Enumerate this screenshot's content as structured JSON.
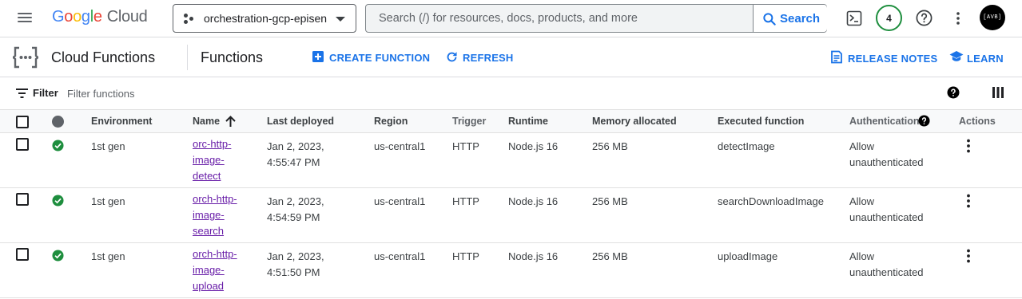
{
  "header": {
    "logo_letters": [
      "G",
      "o",
      "o",
      "g",
      "l",
      "e"
    ],
    "logo_product": "Cloud",
    "project_name": "orchestration-gcp-episen",
    "search_placeholder": "Search (/) for resources, docs, products, and more",
    "search_button": "Search",
    "notification_count": "4",
    "avatar_text": "[AVB]"
  },
  "product": {
    "name": "Cloud Functions",
    "page_title": "Functions",
    "actions": {
      "create": "CREATE FUNCTION",
      "refresh": "REFRESH",
      "release_notes": "RELEASE NOTES",
      "learn": "LEARN"
    }
  },
  "filter": {
    "label": "Filter",
    "placeholder": "Filter functions"
  },
  "table": {
    "columns": {
      "environment": "Environment",
      "name": "Name",
      "last_deployed": "Last deployed",
      "region": "Region",
      "trigger": "Trigger",
      "runtime": "Runtime",
      "memory": "Memory allocated",
      "executed": "Executed function",
      "auth": "Authentication",
      "actions": "Actions"
    },
    "rows": [
      {
        "environment": "1st gen",
        "name_lines": [
          "orc-http-",
          "image-",
          "detect"
        ],
        "deployed_lines": [
          "Jan 2, 2023,",
          "4:55:47 PM"
        ],
        "region": "us-central1",
        "trigger": "HTTP",
        "runtime": "Node.js 16",
        "memory": "256 MB",
        "executed": "detectImage",
        "auth_lines": [
          "Allow",
          "unauthenticated"
        ]
      },
      {
        "environment": "1st gen",
        "name_lines": [
          "orch-http-",
          "image-",
          "search"
        ],
        "deployed_lines": [
          "Jan 2, 2023,",
          "4:54:59 PM"
        ],
        "region": "us-central1",
        "trigger": "HTTP",
        "runtime": "Node.js 16",
        "memory": "256 MB",
        "executed": "searchDownloadImage",
        "auth_lines": [
          "Allow",
          "unauthenticated"
        ]
      },
      {
        "environment": "1st gen",
        "name_lines": [
          "orch-http-",
          "image-",
          "upload"
        ],
        "deployed_lines": [
          "Jan 2, 2023,",
          "4:51:50 PM"
        ],
        "region": "us-central1",
        "trigger": "HTTP",
        "runtime": "Node.js 16",
        "memory": "256 MB",
        "executed": "uploadImage",
        "auth_lines": [
          "Allow",
          "unauthenticated"
        ]
      }
    ]
  },
  "colors": {
    "accent": "#1a73e8",
    "link_visited": "#681da8",
    "status_ok": "#1e8e3e"
  },
  "icons": {
    "menu": "hamburger-icon",
    "project": "project-dots-icon",
    "search": "search-icon",
    "terminal": "cloud-shell-icon",
    "help": "help-icon",
    "more": "more-vert-icon",
    "product": "cloud-functions-icon",
    "create": "add-box-icon",
    "refresh": "refresh-icon",
    "notes": "release-notes-icon",
    "learn": "school-icon",
    "filter": "filter-icon",
    "columns": "column-display-icon",
    "status": "check-circle-icon",
    "sort": "arrow-upward-icon"
  }
}
